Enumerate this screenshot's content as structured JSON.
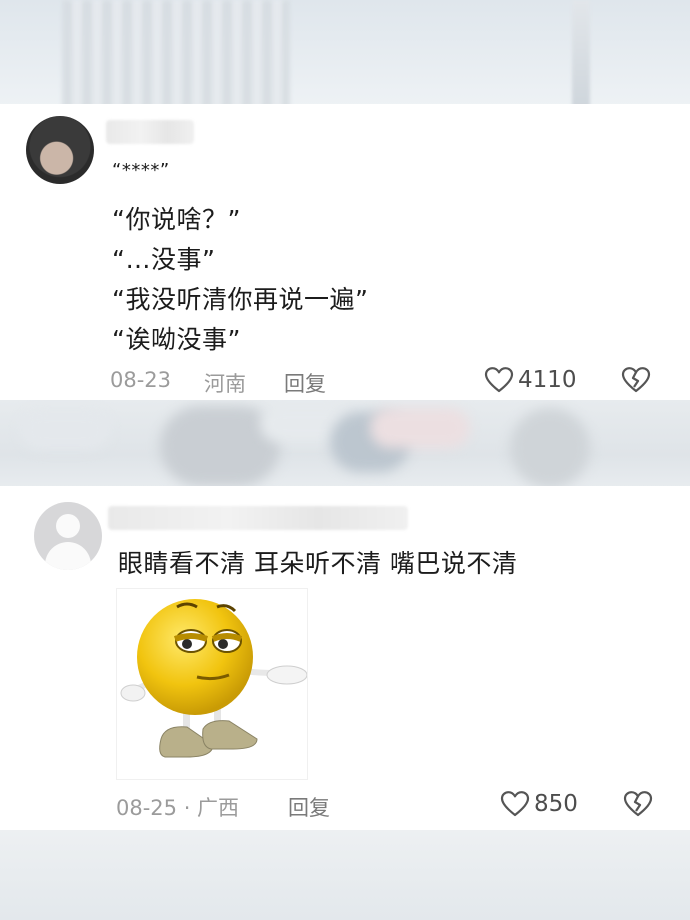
{
  "comments": [
    {
      "lines": [
        "“****”",
        "“你说啥？”",
        "“…没事”",
        "“我没听清你再说一遍”",
        "“诶呦没事”"
      ],
      "date": "08-23",
      "location": "河南",
      "reply_label": "回复",
      "likes": "4110"
    },
    {
      "text": "眼睛看不清  耳朵听不清  嘴巴说不清",
      "sticker": "shrugging-emoji-sticker",
      "date": "08-25 · 广西",
      "reply_label": "回复",
      "likes": "850"
    }
  ],
  "icons": {
    "like": "heart-outline-icon",
    "dislike": "broken-heart-icon"
  },
  "colors": {
    "text": "#1c1c1c",
    "meta": "#9b9b9b",
    "card": "#ffffff"
  }
}
